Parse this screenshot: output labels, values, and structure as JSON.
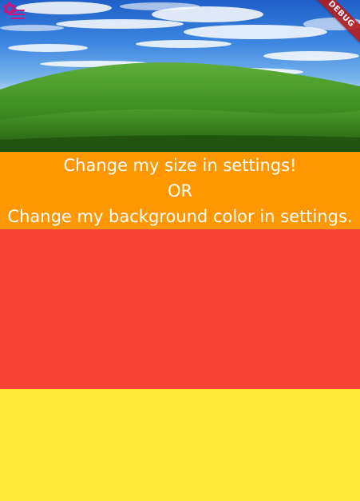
{
  "app_bar": {
    "menu_icon": "menu-icon",
    "settings_icon": "settings-icon",
    "icon_color": "#c8177e"
  },
  "debug_banner": {
    "label": "DEBUG"
  },
  "info_panel": {
    "line1": "Change my size in settings!",
    "line2": "OR",
    "line3": "Change my background color in settings.",
    "background": "#ff9800",
    "text_color": "#ffffff"
  },
  "panels": {
    "red": "#f44336",
    "yellow": "#ffeb3b"
  }
}
